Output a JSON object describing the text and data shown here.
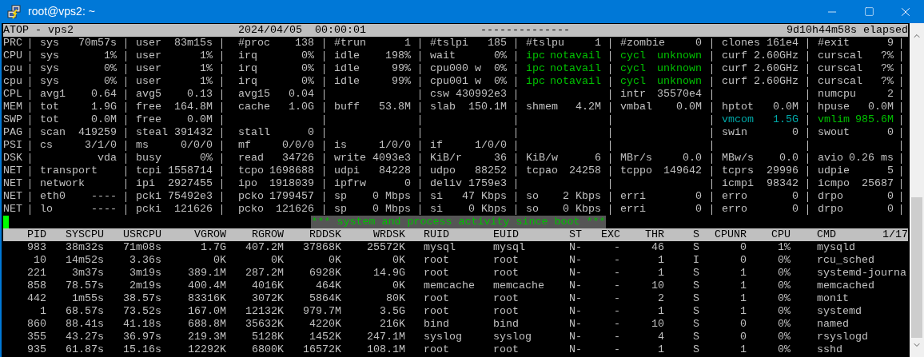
{
  "window": {
    "title": "root@vps2: ~"
  },
  "header": {
    "title": "ATOP - vps2",
    "date": "2024/04/05",
    "time": "00:00:01",
    "dashes": "--------------",
    "elapsed": "9d10h44m58s elapsed"
  },
  "system": [
    {
      "label": "PRC",
      "cells": [
        {
          "key": "sys",
          "value": "70m57s"
        },
        {
          "key": "user",
          "value": "83m15s"
        },
        {
          "key": "#proc",
          "value": "138"
        },
        {
          "key": "#trun",
          "value": "1"
        },
        {
          "key": "#tslpi",
          "value": "185"
        },
        {
          "key": "#tslpu",
          "value": "1"
        },
        {
          "key": "#zombie",
          "value": "0"
        },
        {
          "key": "clones",
          "value": "161e4"
        },
        {
          "key": "#exit",
          "value": "9"
        }
      ]
    },
    {
      "label": "CPU",
      "cells": [
        {
          "key": "sys",
          "value": "1%"
        },
        {
          "key": "user",
          "value": "1%"
        },
        {
          "key": "irq",
          "value": "0%"
        },
        {
          "key": "idle",
          "value": "198%"
        },
        {
          "key": "wait",
          "value": "0%"
        },
        {
          "key": "ipc",
          "value": "notavail",
          "color": "#00c000"
        },
        {
          "key": "cycl",
          "value": "unknown",
          "color": "#00c000"
        },
        {
          "key": "curf",
          "value": "2.60GHz"
        },
        {
          "key": "curscal",
          "value": "?%"
        }
      ]
    },
    {
      "label": "cpu",
      "cells": [
        {
          "key": "sys",
          "value": "0%"
        },
        {
          "key": "user",
          "value": "1%"
        },
        {
          "key": "irq",
          "value": "0%"
        },
        {
          "key": "idle",
          "value": "99%"
        },
        {
          "key": "cpu000 w",
          "value": "0%"
        },
        {
          "key": "ipc",
          "value": "notavail",
          "color": "#00c000"
        },
        {
          "key": "cycl",
          "value": "unknown",
          "color": "#00c000"
        },
        {
          "key": "curf",
          "value": "2.60GHz"
        },
        {
          "key": "curscal",
          "value": "?%"
        }
      ]
    },
    {
      "label": "cpu",
      "cells": [
        {
          "key": "sys",
          "value": "0%"
        },
        {
          "key": "user",
          "value": "1%"
        },
        {
          "key": "irq",
          "value": "0%"
        },
        {
          "key": "idle",
          "value": "99%"
        },
        {
          "key": "cpu001 w",
          "value": "0%"
        },
        {
          "key": "ipc",
          "value": "notavail",
          "color": "#00c000"
        },
        {
          "key": "cycl",
          "value": "unknown",
          "color": "#00c000"
        },
        {
          "key": "curf",
          "value": "2.60GHz"
        },
        {
          "key": "curscal",
          "value": "?%"
        }
      ]
    },
    {
      "label": "CPL",
      "cells": [
        {
          "key": "avg1",
          "value": "0.64"
        },
        {
          "key": "avg5",
          "value": "0.13"
        },
        {
          "key": "avg15",
          "value": "0.04"
        },
        null,
        {
          "key": "csw",
          "value": "430992e3"
        },
        null,
        {
          "key": "intr",
          "value": "35570e4"
        },
        null,
        {
          "key": "numcpu",
          "value": "2"
        }
      ]
    },
    {
      "label": "MEM",
      "cells": [
        {
          "key": "tot",
          "value": "1.9G"
        },
        {
          "key": "free",
          "value": "164.8M"
        },
        {
          "key": "cache",
          "value": "1.0G"
        },
        {
          "key": "buff",
          "value": "53.8M"
        },
        {
          "key": "slab",
          "value": "150.1M"
        },
        {
          "key": "shmem",
          "value": "4.2M"
        },
        {
          "key": "vmbal",
          "value": "0.0M"
        },
        {
          "key": "hptot",
          "value": "0.0M"
        },
        {
          "key": "hpuse",
          "value": "0.0M"
        }
      ]
    },
    {
      "label": "SWP",
      "cells": [
        {
          "key": "tot",
          "value": "0.0M"
        },
        {
          "key": "free",
          "value": "0.0M"
        },
        null,
        null,
        null,
        null,
        null,
        {
          "key": "vmcom",
          "value": "1.5G",
          "color": "#00a8a8"
        },
        {
          "key": "vmlim",
          "value": "985.6M",
          "color": "#00c000"
        }
      ]
    },
    {
      "label": "PAG",
      "cells": [
        {
          "key": "scan",
          "value": "419259"
        },
        {
          "key": "steal",
          "value": "391432"
        },
        {
          "key": "stall",
          "value": "0"
        },
        null,
        null,
        null,
        null,
        {
          "key": "swin",
          "value": "0"
        },
        {
          "key": "swout",
          "value": "0"
        }
      ]
    },
    {
      "label": "PSI",
      "cells": [
        {
          "key": "cs",
          "value": "3/1/0"
        },
        {
          "key": "ms",
          "value": "0/0/0"
        },
        {
          "key": "mf",
          "value": "0/0/0"
        },
        {
          "key": "is",
          "value": "1/0/0"
        },
        {
          "key": "if",
          "value": "1/0/0"
        },
        null,
        null,
        null,
        null
      ]
    },
    {
      "label": "DSK",
      "cells": [
        {
          "value": "vda"
        },
        {
          "key": "busy",
          "value": "0%"
        },
        {
          "key": "read",
          "value": "34726"
        },
        {
          "key": "write",
          "value": "4093e3"
        },
        {
          "key": "KiB/r",
          "value": "36"
        },
        {
          "key": "KiB/w",
          "value": "6"
        },
        {
          "key": "MBr/s",
          "value": "0.0"
        },
        {
          "key": "MBw/s",
          "value": "0.0"
        },
        {
          "key": "avio",
          "value": "0.26 ms"
        }
      ]
    },
    {
      "label": "NET",
      "cells": [
        {
          "key": "transport"
        },
        {
          "key": "tcpi",
          "value": "1558714"
        },
        {
          "key": "tcpo",
          "value": "1698688"
        },
        {
          "key": "udpi",
          "value": "84228"
        },
        {
          "key": "udpo",
          "value": "88252"
        },
        {
          "key": "tcpao",
          "value": "24258"
        },
        {
          "key": "tcppo",
          "value": "149642"
        },
        {
          "key": "tcprs",
          "value": "29996"
        },
        {
          "key": "udpie",
          "value": "5"
        }
      ]
    },
    {
      "label": "NET",
      "cells": [
        {
          "key": "network"
        },
        {
          "key": "ipi",
          "value": "2927455"
        },
        {
          "key": "ipo",
          "value": "1918039"
        },
        {
          "key": "ipfrw",
          "value": "0"
        },
        {
          "key": "deliv",
          "value": "1759e3"
        },
        null,
        null,
        {
          "key": "icmpi",
          "value": "98342"
        },
        {
          "key": "icmpo",
          "value": "25687"
        }
      ]
    },
    {
      "label": "NET",
      "cells": [
        {
          "key": "eth0",
          "value": "----"
        },
        {
          "key": "pcki",
          "value": "75492e3"
        },
        {
          "key": "pcko",
          "value": "1799457"
        },
        {
          "key": "sp",
          "value": "0 Mbps"
        },
        {
          "key": "si",
          "value": "47 Kbps"
        },
        {
          "key": "so",
          "value": "2 Kbps"
        },
        {
          "key": "erri",
          "value": "0"
        },
        {
          "key": "erro",
          "value": "0"
        },
        {
          "key": "drpo",
          "value": "0"
        }
      ]
    },
    {
      "label": "NET",
      "cells": [
        {
          "key": "lo",
          "value": "----"
        },
        {
          "key": "pcki",
          "value": "121626"
        },
        {
          "key": "pcko",
          "value": "121626"
        },
        {
          "key": "sp",
          "value": "0 Mbps"
        },
        {
          "key": "si",
          "value": "0 Kbps"
        },
        {
          "key": "so",
          "value": "0 Kbps"
        },
        {
          "key": "erri",
          "value": "0"
        },
        {
          "key": "erro",
          "value": "0"
        },
        {
          "key": "drpo",
          "value": "0"
        }
      ]
    }
  ],
  "banner": "*** system and process activity since boot ***",
  "processes": {
    "columns": [
      "PID",
      "SYSCPU",
      "USRCPU",
      "VGROW",
      "RGROW",
      "RDDSK",
      "WRDSK",
      "RUID",
      "EUID",
      "ST",
      "EXC",
      "THR",
      "S",
      "CPUNR",
      "CPU",
      "CMD"
    ],
    "page": "1/17",
    "rows": [
      [
        "983",
        "38m32s",
        "71m08s",
        "1.7G",
        "407.2M",
        "37868K",
        "25572K",
        "mysql",
        "mysql",
        "N-",
        "-",
        "46",
        "S",
        "0",
        "1%",
        "mysqld"
      ],
      [
        "10",
        "14m52s",
        "3.36s",
        "0K",
        "0K",
        "0K",
        "0K",
        "root",
        "root",
        "N-",
        "-",
        "1",
        "I",
        "0",
        "0%",
        "rcu_sched"
      ],
      [
        "221",
        "3m37s",
        "3m19s",
        "389.1M",
        "287.2M",
        "6928K",
        "14.9G",
        "root",
        "root",
        "N-",
        "-",
        "1",
        "S",
        "1",
        "0%",
        "systemd-journa"
      ],
      [
        "858",
        "78.57s",
        "2m19s",
        "400.4M",
        "4016K",
        "464K",
        "0K",
        "memcache",
        "memcache",
        "N-",
        "-",
        "10",
        "S",
        "1",
        "0%",
        "memcached"
      ],
      [
        "442",
        "1m55s",
        "38.57s",
        "83316K",
        "3072K",
        "5864K",
        "80K",
        "root",
        "root",
        "N-",
        "-",
        "2",
        "S",
        "1",
        "0%",
        "monit"
      ],
      [
        "1",
        "68.57s",
        "73.52s",
        "167.0M",
        "12132K",
        "979.7M",
        "3.5G",
        "root",
        "root",
        "N-",
        "-",
        "1",
        "S",
        "1",
        "0%",
        "systemd"
      ],
      [
        "860",
        "88.41s",
        "41.18s",
        "688.8M",
        "35632K",
        "4220K",
        "216K",
        "bind",
        "bind",
        "N-",
        "-",
        "10",
        "S",
        "0",
        "0%",
        "named"
      ],
      [
        "355",
        "43.27s",
        "36.97s",
        "219.3M",
        "5128K",
        "1452K",
        "247.1M",
        "syslog",
        "syslog",
        "N-",
        "-",
        "4",
        "S",
        "0",
        "0%",
        "rsyslogd"
      ],
      [
        "935",
        "61.87s",
        "15.16s",
        "12292K",
        "6800K",
        "16572K",
        "108.1M",
        "root",
        "root",
        "N-",
        "-",
        "1",
        "S",
        "1",
        "0%",
        "sshd"
      ]
    ]
  }
}
